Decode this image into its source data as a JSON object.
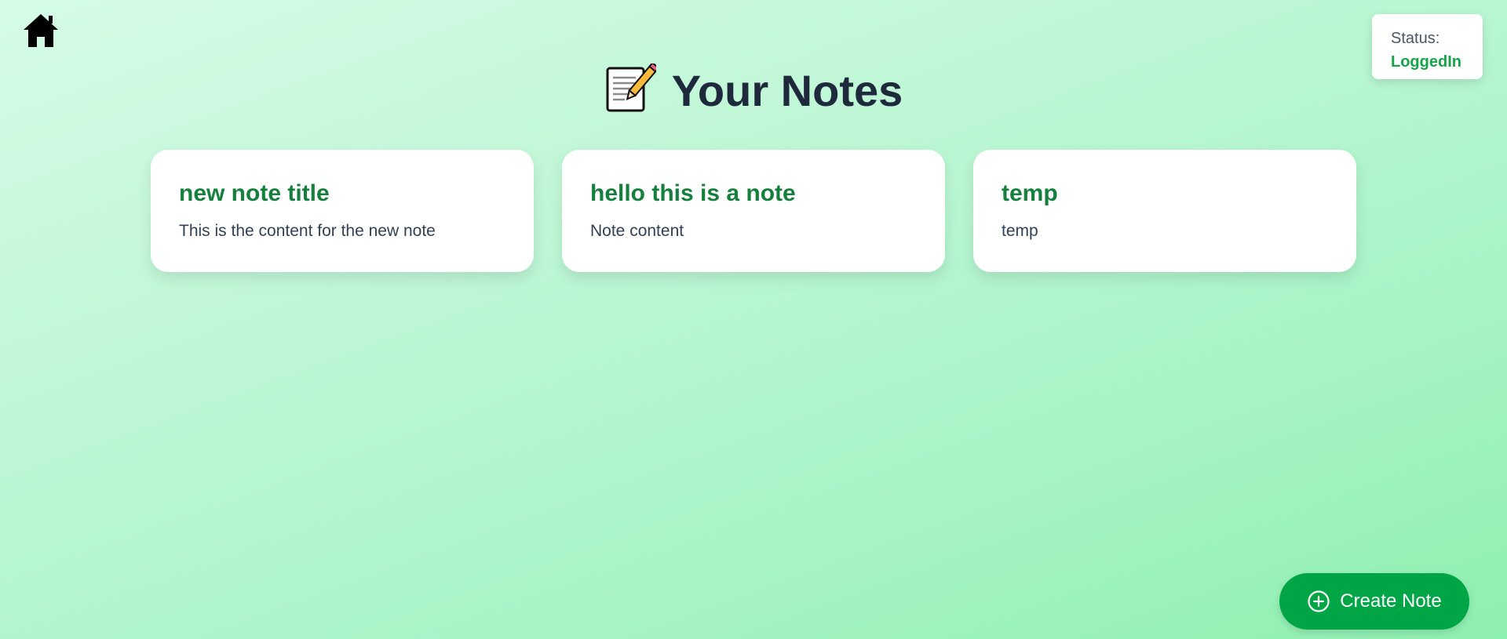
{
  "nav": {
    "home_icon": "home-icon"
  },
  "status": {
    "label": "Status:",
    "value": "LoggedIn",
    "value_color": "#16a34a"
  },
  "header": {
    "emoji": "memo-emoji",
    "title": "Your Notes"
  },
  "notes": [
    {
      "title": "new note title",
      "content": "This is the content for the new note"
    },
    {
      "title": "hello this is a note",
      "content": "Note content"
    },
    {
      "title": "temp",
      "content": "temp"
    }
  ],
  "actions": {
    "create_icon": "plus-circle-icon",
    "create_label": "Create Note"
  },
  "colors": {
    "accent": "#00a645",
    "note_title": "#15803d",
    "title_text": "#1e293b"
  }
}
